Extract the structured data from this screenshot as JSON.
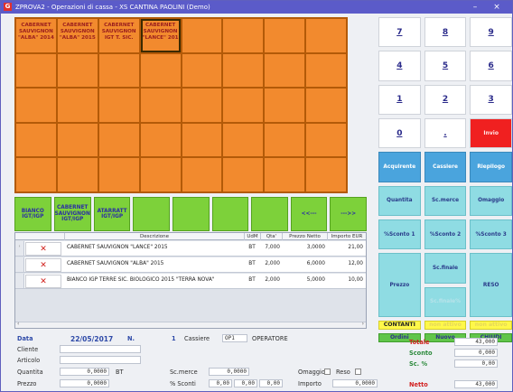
{
  "window": {
    "title": "ZPROVA2 - Operazioni di cassa - XS  CANTINA PAOLINI  (Demo)",
    "minimize": "–",
    "close": "×"
  },
  "products": [
    "CABERNET SAUVIGNON \"ALBA\" 2014",
    "CABERNET SAUVIGNON \"ALBA\" 2015",
    "CABERNET SAUVIGNON IGT T. SIC.",
    "CABERNET SAUVIGNON \"LANCE\" 201"
  ],
  "categories": [
    "BIANCO IGT/IGP",
    "CABERNET SAUVIGNON IGT/IGP",
    "ATARRATT IGT/IGP",
    "",
    "",
    "",
    "",
    "<<---",
    "--->>"
  ],
  "table": {
    "headers": [
      "Descrizione",
      "UdM",
      "Qta'",
      "Prezzo Netto",
      "Importo EUR"
    ],
    "rows": [
      {
        "desc": "CABERNET SAUVIGNON \"LANCE\" 2015",
        "udm": "BT",
        "qta": "7,000",
        "prezzo": "3,0000",
        "importo": "21,00"
      },
      {
        "desc": "CABERNET SAUVIGNON \"ALBA\" 2015",
        "udm": "BT",
        "qta": "2,000",
        "prezzo": "6,0000",
        "importo": "12,00"
      },
      {
        "desc": "BIANCO IGP TERRE SIC. BIOLOGICO 2015 \"TERRA NOVA\"",
        "udm": "BT",
        "qta": "2,000",
        "prezzo": "5,0000",
        "importo": "10,00"
      }
    ],
    "delete_glyph": "✕"
  },
  "keypad": {
    "keys": [
      "7",
      "8",
      "9",
      "4",
      "5",
      "6",
      "1",
      "2",
      "3",
      "0",
      ".",
      "Invio"
    ],
    "acquirente": "Acquirente",
    "cassiere": "Cassiere",
    "riepilogo": "Riepilogo",
    "quantita": "Quantita",
    "scmerce": "Sc.merce",
    "omaggio": "Omaggio",
    "sconto1": "%Sconto 1",
    "sconto2": "%Sconto 2",
    "sconto3": "%Sconto 3",
    "prezzo": "Prezzo",
    "scfinale": "Sc.finale",
    "scfinale2": "Sc.finale%",
    "reso": "RESO",
    "contanti": "CONTANTI",
    "nonattivo1": "non attivo",
    "nonattivo2": "non attivo",
    "ordini": "Ordini",
    "nuovo": "Nuovo",
    "chiudi": "CHIUDI"
  },
  "footer": {
    "data_label": "Data",
    "data_value": "22/05/2017",
    "n_label": "N.",
    "n_value": "1",
    "cassiere_label": "Cassiere",
    "cassiere_code": "OP1",
    "cassiere_name": "OPERATORE",
    "cliente_label": "Cliente",
    "articolo_label": "Articolo",
    "quantita_label": "Quantita",
    "quantita_value": "0,0000",
    "quantita_udm": "BT",
    "prezzo_label": "Prezzo",
    "prezzo_value": "0,0000",
    "scmerce_label": "Sc.merce",
    "scmerce_value": "0,0000",
    "sconti_label": "% Sconti",
    "sconti_values": [
      "0,00",
      "0,00",
      "0,00"
    ],
    "omaggio_label": "Omaggio",
    "reso_label": "Reso",
    "importo_label": "Importo",
    "importo_value": "0,0000",
    "totale_label": "Totale",
    "totale_value": "43,000",
    "sconto_label": "Sconto",
    "sconto_value": "0,000",
    "scperc_label": "Sc. %",
    "scperc_value": "0,00",
    "netto_label": "Netto",
    "netto_value": "43,000"
  }
}
